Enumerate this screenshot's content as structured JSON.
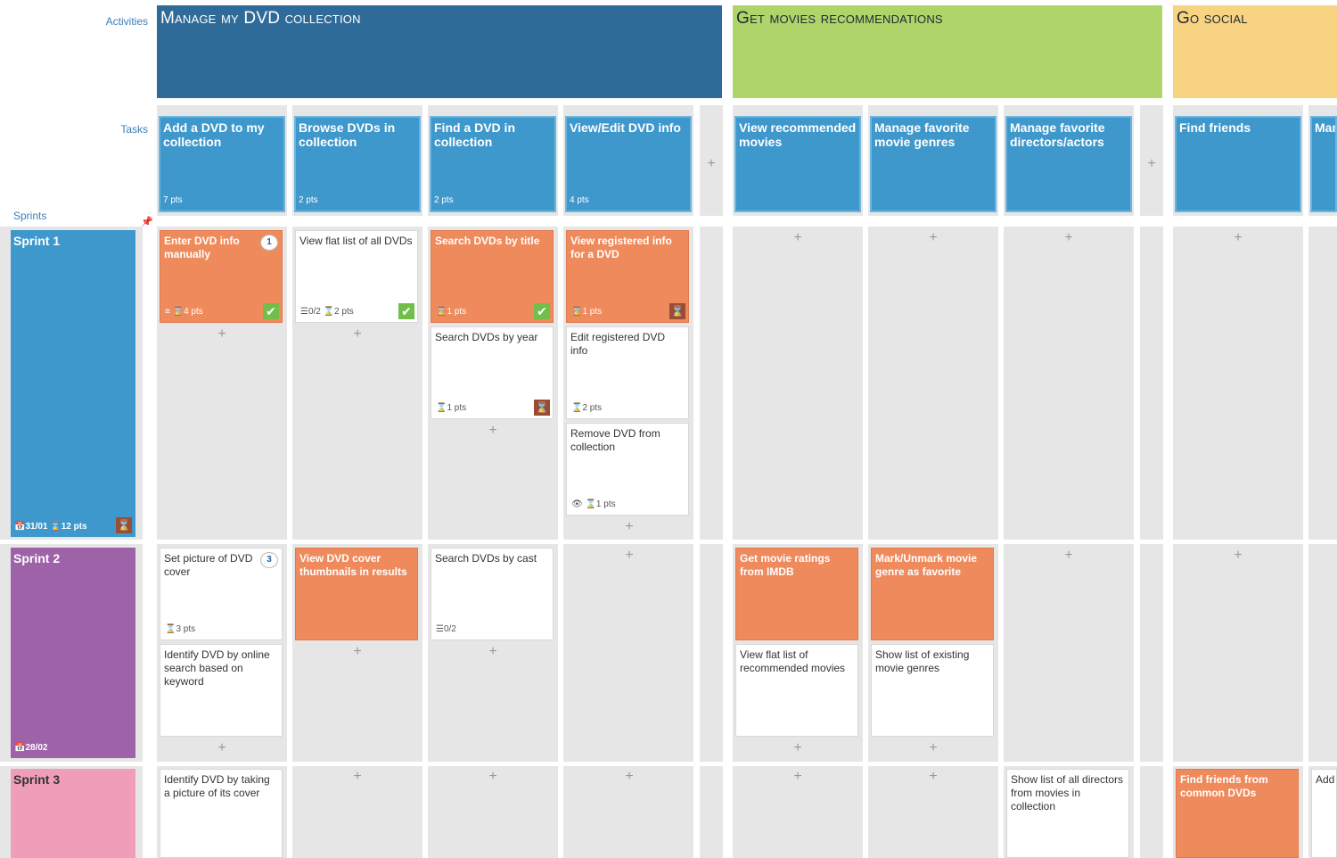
{
  "row_labels": {
    "activities": "Activities",
    "tasks": "Tasks",
    "sprints": "Sprints"
  },
  "activities": [
    {
      "title": "Manage my DVD collection",
      "color": "#2e6b99"
    },
    {
      "title": "Get movies recommendations",
      "color": "#aed46a"
    },
    {
      "title": "Go social",
      "color": "#f8d382"
    }
  ],
  "tasks": [
    {
      "title": "Add a DVD to my collection",
      "pts": "7 pts"
    },
    {
      "title": "Browse DVDs in collection",
      "pts": "2 pts"
    },
    {
      "title": "Find a DVD in collection",
      "pts": "2 pts"
    },
    {
      "title": "View/Edit DVD info",
      "pts": "4 pts"
    },
    {
      "title": "View recommended movies",
      "pts": ""
    },
    {
      "title": "Manage favorite movie genres",
      "pts": ""
    },
    {
      "title": "Manage favorite directors/actors",
      "pts": ""
    },
    {
      "title": "Find friends",
      "pts": ""
    },
    {
      "title": "Man wish",
      "pts": ""
    }
  ],
  "sprints": [
    {
      "name": "Sprint 1",
      "date": "31/01",
      "pts": "12 pts",
      "color": "#3e98cc"
    },
    {
      "name": "Sprint 2",
      "date": "28/02",
      "pts": "",
      "color": "#9d62a8"
    },
    {
      "name": "Sprint 3",
      "date": "",
      "pts": "",
      "color": "#f09dba"
    }
  ],
  "cards": {
    "c1": {
      "title": "Enter DVD info manually",
      "meta": "≡ ⌛4 pts",
      "bubble": "1"
    },
    "c2": {
      "title": "View flat list of all DVDs",
      "meta": "☰0/2 ⌛2 pts"
    },
    "c3": {
      "title": "Search DVDs by title",
      "meta": "⌛1 pts"
    },
    "c4": {
      "title": "View registered info for a DVD",
      "meta": "⌛1 pts"
    },
    "c5": {
      "title": "Search DVDs by year",
      "meta": "⌛1 pts"
    },
    "c6": {
      "title": "Edit registered DVD info",
      "meta": "⌛2 pts"
    },
    "c7": {
      "title": "Remove DVD from collection",
      "meta": "👁 ⌛1 pts"
    },
    "c8": {
      "title": "Set picture of DVD cover",
      "meta": "⌛3 pts",
      "bubble": "3"
    },
    "c9": {
      "title": "View DVD cover thumbnails in results",
      "meta": ""
    },
    "c10": {
      "title": "Search DVDs by cast",
      "meta": "☰0/2"
    },
    "c11": {
      "title": "Identify DVD by online search based on keyword",
      "meta": ""
    },
    "c12": {
      "title": "Get movie ratings from IMDB",
      "meta": ""
    },
    "c13": {
      "title": "Mark/Unmark movie genre as favorite",
      "meta": ""
    },
    "c14": {
      "title": "View flat list of recommended movies",
      "meta": ""
    },
    "c15": {
      "title": "Show list of existing movie genres",
      "meta": ""
    },
    "c16": {
      "title": "Identify DVD by taking a picture of its cover",
      "meta": ""
    },
    "c17": {
      "title": "Show list of all directors from movies in collection",
      "meta": ""
    },
    "c18": {
      "title": "Find friends from common DVDs",
      "meta": ""
    },
    "c19": {
      "title": "Add",
      "meta": ""
    }
  },
  "plus_symbol": "+",
  "icons": {
    "check": "✔",
    "hourglass": "⌛",
    "pin": "📌"
  }
}
